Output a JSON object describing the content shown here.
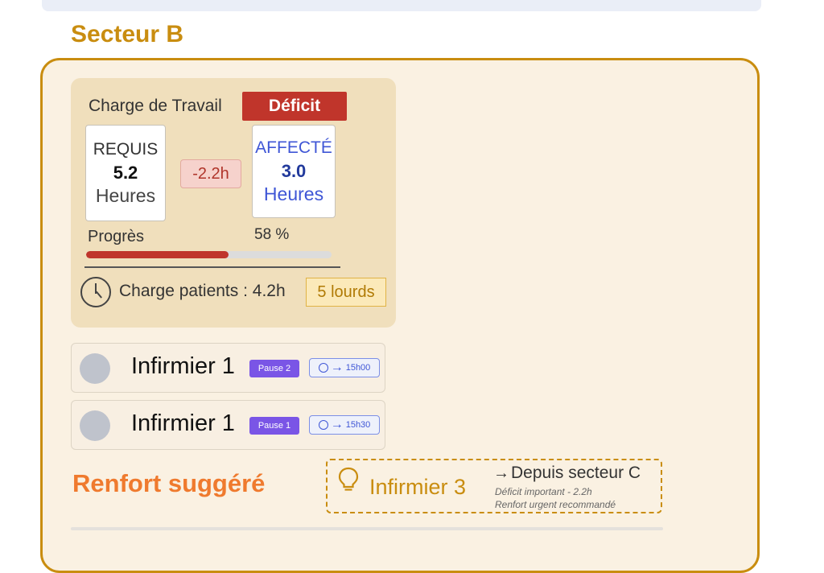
{
  "sector": {
    "title": "Secteur B"
  },
  "workload": {
    "title": "Charge de Travail",
    "status_label": "Déficit",
    "required": {
      "label": "REQUIS",
      "value": "5.2",
      "unit": "Heures"
    },
    "difference": "-2.2h",
    "assigned": {
      "label": "AFFECTÉ",
      "value": "3.0",
      "unit": "Heures"
    },
    "progress": {
      "label": "Progrès",
      "percent_text": "58 %",
      "value": 58
    },
    "patient_load": "Charge patients : 4.2h",
    "heavy_count": "5 lourds"
  },
  "nurses": [
    {
      "name": "Infirmier 1",
      "pause": "Pause 2",
      "time": "15h00"
    },
    {
      "name": "Infirmier 1",
      "pause": "Pause 1",
      "time": "15h30"
    }
  ],
  "reinforcement": {
    "title": "Renfort suggéré",
    "nurse": "Infirmier 3",
    "source": "Depuis secteur C",
    "detail_1": "Déficit important - 2.2h",
    "detail_2": "Renfort urgent recommandé"
  },
  "colors": {
    "accent": "#c98d10",
    "deficit": "#c0352b",
    "assigned": "#3f56d6",
    "pause": "#7a55e6",
    "reinforce": "#ef7a2e"
  }
}
